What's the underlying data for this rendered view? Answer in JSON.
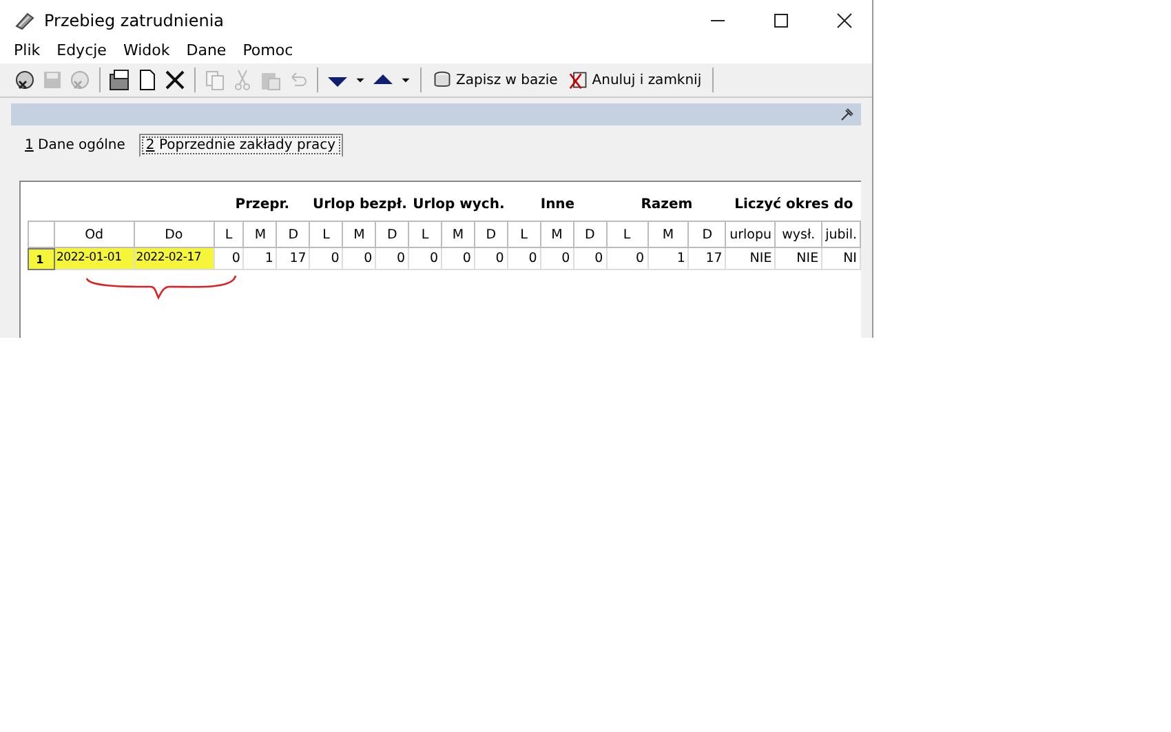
{
  "window": {
    "title": "Przebieg zatrudnienia"
  },
  "menu": [
    "Plik",
    "Edycje",
    "Widok",
    "Dane",
    "Pomoc"
  ],
  "toolbar": [
    {
      "kind": "icon",
      "disabled": false
    },
    {
      "kind": "icon",
      "disabled": true
    },
    {
      "kind": "icon",
      "disabled": true
    },
    {
      "kind": "sep"
    },
    {
      "kind": "icon",
      "disabled": false
    },
    {
      "kind": "icon",
      "disabled": false
    },
    {
      "kind": "icon",
      "disabled": false
    },
    {
      "kind": "sep"
    },
    {
      "kind": "icon",
      "disabled": true
    },
    {
      "kind": "icon",
      "disabled": true
    },
    {
      "kind": "icon",
      "disabled": true
    },
    {
      "kind": "icon",
      "disabled": true
    },
    {
      "kind": "sep"
    },
    {
      "kind": "icon",
      "disabled": false
    },
    {
      "kind": "icon",
      "disabled": false
    },
    {
      "kind": "icon",
      "disabled": false
    },
    {
      "kind": "icon",
      "disabled": false
    },
    {
      "kind": "sep"
    },
    {
      "kind": "text",
      "label": "Zapisz w bazie"
    },
    {
      "kind": "text",
      "label": "Anuluj i zamknij"
    },
    {
      "kind": "sep"
    }
  ],
  "tabs": [
    {
      "label": "1 Dane ogólne",
      "selected": false
    },
    {
      "label": "2 Poprzednie zakłady pracy",
      "selected": true
    }
  ],
  "table": {
    "groups": [
      "Przepr.",
      "Urlop bezpł.",
      "Urlop wych.",
      "Inne",
      "Razem",
      "Liczyć okres do"
    ],
    "columns": [
      "",
      "Od",
      "Do",
      "L",
      "M",
      "D",
      "L",
      "M",
      "D",
      "L",
      "M",
      "D",
      "L",
      "M",
      "D",
      "L",
      "M",
      "D",
      "urlopu",
      "wysł.",
      "jubil."
    ],
    "rows": [
      {
        "selected": true,
        "cells": [
          {
            "text": "1",
            "highlighted": true
          },
          {
            "text": "2022-01-01",
            "highlighted": true
          },
          {
            "text": "2022-02-17",
            "highlighted": true
          },
          {
            "text": "0",
            "highlighted": false
          },
          {
            "text": "1",
            "highlighted": false
          },
          {
            "text": "17",
            "highlighted": false
          },
          {
            "text": "0",
            "highlighted": false
          },
          {
            "text": "0",
            "highlighted": false
          },
          {
            "text": "0",
            "highlighted": false
          },
          {
            "text": "0",
            "highlighted": false
          },
          {
            "text": "0",
            "highlighted": false
          },
          {
            "text": "0",
            "highlighted": false
          },
          {
            "text": "0",
            "highlighted": false
          },
          {
            "text": "0",
            "highlighted": false
          },
          {
            "text": "0",
            "highlighted": false
          },
          {
            "text": "0",
            "highlighted": false
          },
          {
            "text": "1",
            "highlighted": false
          },
          {
            "text": "17",
            "highlighted": false
          },
          {
            "text": "NIE",
            "highlighted": false
          },
          {
            "text": "NIE",
            "highlighted": false
          },
          {
            "text": "NI",
            "highlighted": false
          }
        ]
      }
    ]
  }
}
